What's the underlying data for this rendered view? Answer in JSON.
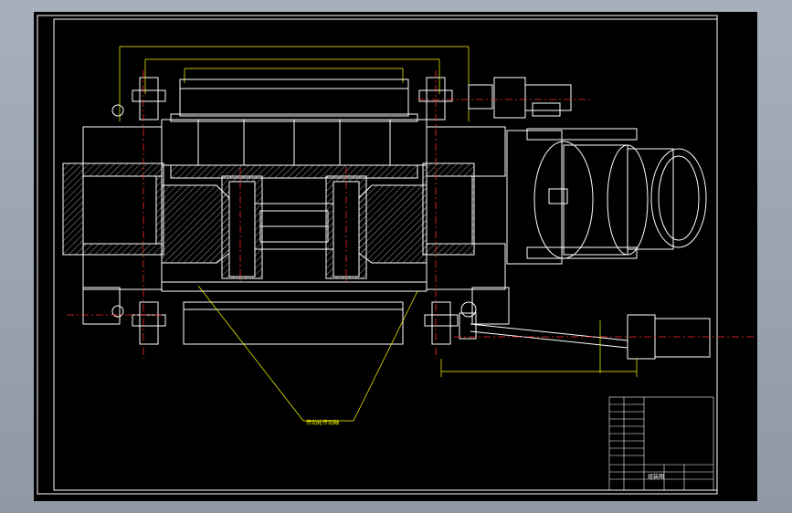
{
  "viewport": {
    "background": "#000000",
    "frame_color": "#ffffff"
  },
  "colors": {
    "outline": "#ffffff",
    "dimension": "#ffff00",
    "centerline": "#ff2a2a",
    "hatch": "#ffffff"
  },
  "annotations": {
    "leader_label": "传动轮传动轴",
    "title_block_label": "组装图"
  },
  "icons": [
    "motor-icon",
    "gearbox-icon",
    "bearing-block-icon",
    "connecting-rod-icon"
  ]
}
